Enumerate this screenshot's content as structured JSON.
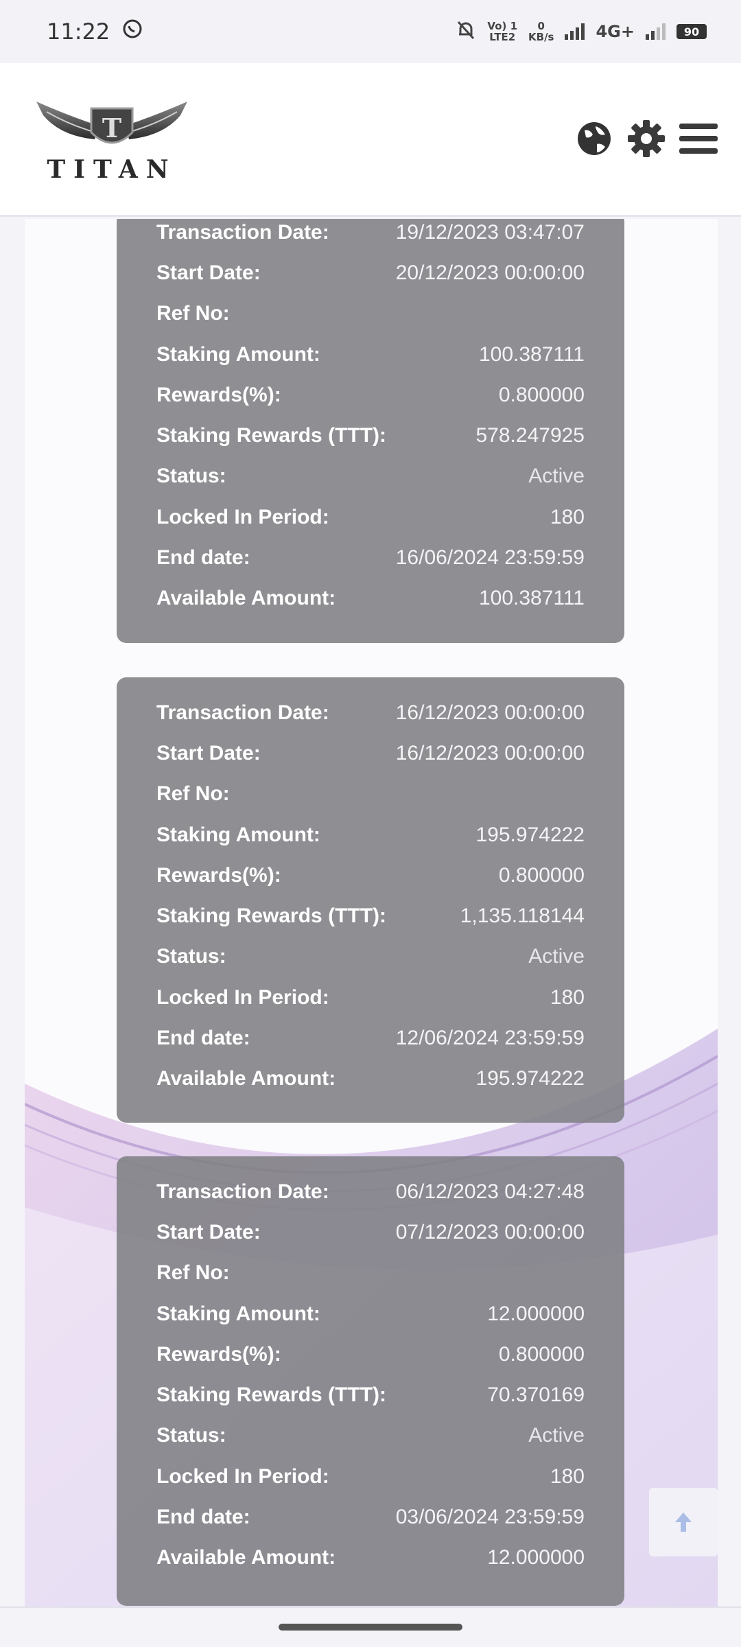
{
  "status_bar": {
    "time": "11:22",
    "network_line1": "Vo) 1",
    "network_line2": "LTE2",
    "speed_value": "0",
    "speed_unit": "KB/s",
    "net_type": "4G+",
    "battery": "90"
  },
  "header": {
    "brand": "TITAN",
    "logo_letter": "T",
    "icons": [
      "globe-icon",
      "gear-icon",
      "menu-icon"
    ]
  },
  "cards": [
    {
      "rows": [
        {
          "label": "Transaction Date:",
          "value": "19/12/2023 03:47:07"
        },
        {
          "label": "Start Date:",
          "value": "20/12/2023 00:00:00"
        },
        {
          "label": "Ref No:",
          "value": ""
        },
        {
          "label": "Staking Amount:",
          "value": "100.387111"
        },
        {
          "label": "Rewards(%):",
          "value": "0.800000"
        },
        {
          "label": "Staking Rewards (TTT):",
          "value": "578.247925"
        },
        {
          "label": "Status:",
          "value": "Active"
        },
        {
          "label": "Locked In Period:",
          "value": "180"
        },
        {
          "label": "End date:",
          "value": "16/06/2024 23:59:59"
        },
        {
          "label": "Available Amount:",
          "value": "100.387111"
        }
      ]
    },
    {
      "rows": [
        {
          "label": "Transaction Date:",
          "value": "16/12/2023 00:00:00"
        },
        {
          "label": "Start Date:",
          "value": "16/12/2023 00:00:00"
        },
        {
          "label": "Ref No:",
          "value": ""
        },
        {
          "label": "Staking Amount:",
          "value": "195.974222"
        },
        {
          "label": "Rewards(%):",
          "value": "0.800000"
        },
        {
          "label": "Staking Rewards (TTT):",
          "value": "1,135.118144"
        },
        {
          "label": "Status:",
          "value": "Active"
        },
        {
          "label": "Locked In Period:",
          "value": "180"
        },
        {
          "label": "End date:",
          "value": "12/06/2024 23:59:59"
        },
        {
          "label": "Available Amount:",
          "value": "195.974222"
        }
      ]
    },
    {
      "rows": [
        {
          "label": "Transaction Date:",
          "value": "06/12/2023 04:27:48"
        },
        {
          "label": "Start Date:",
          "value": "07/12/2023 00:00:00"
        },
        {
          "label": "Ref No:",
          "value": ""
        },
        {
          "label": "Staking Amount:",
          "value": "12.000000"
        },
        {
          "label": "Rewards(%):",
          "value": "0.800000"
        },
        {
          "label": "Staking Rewards (TTT):",
          "value": "70.370169"
        },
        {
          "label": "Status:",
          "value": "Active"
        },
        {
          "label": "Locked In Period:",
          "value": "180"
        },
        {
          "label": "End date:",
          "value": "03/06/2024 23:59:59"
        },
        {
          "label": "Available Amount:",
          "value": "12.000000"
        }
      ]
    }
  ]
}
